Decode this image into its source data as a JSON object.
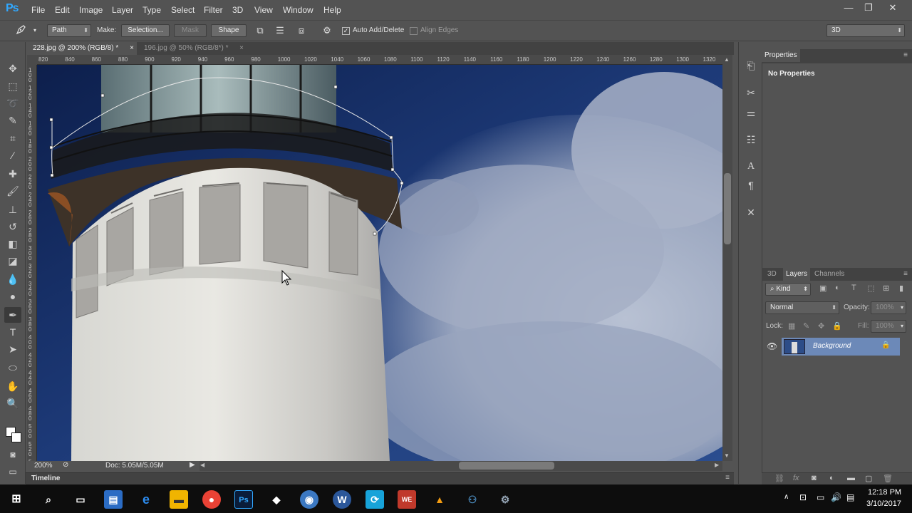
{
  "app": {
    "logo": "Ps",
    "menu": [
      "File",
      "Edit",
      "Image",
      "Layer",
      "Type",
      "Select",
      "Filter",
      "3D",
      "View",
      "Window",
      "Help"
    ],
    "window_controls": {
      "minimize": "—",
      "restore": "❐",
      "close": "✕"
    },
    "accent_color": "#31a8ff"
  },
  "options_bar": {
    "tool_icon": "pen-icon",
    "mode": "Path",
    "make_label": "Make:",
    "selection_btn": "Selection...",
    "mask_btn": "Mask",
    "shape_btn": "Shape",
    "auto_add_delete": {
      "label": "Auto Add/Delete",
      "checked": true
    },
    "align_edges": {
      "label": "Align Edges",
      "checked": false
    },
    "workspace": "3D"
  },
  "document_tabs": [
    {
      "label": "228.jpg @ 200% (RGB/8) *",
      "close": "×",
      "active": true
    },
    {
      "label": "196.jpg @ 50% (RGB/8*) *",
      "close": "×",
      "active": false
    }
  ],
  "rulers": {
    "horizontal": [
      "820",
      "840",
      "860",
      "880",
      "900",
      "920",
      "940",
      "960",
      "980",
      "1000",
      "1020",
      "1040",
      "1060",
      "1080",
      "1100",
      "1120",
      "1140",
      "1160",
      "1180",
      "1200",
      "1220",
      "1240",
      "1260",
      "1280",
      "1300",
      "1320"
    ],
    "vertical": [
      "100",
      "120",
      "140",
      "160",
      "180",
      "200",
      "220",
      "240",
      "260",
      "280",
      "300",
      "320",
      "340",
      "360",
      "380",
      "400",
      "420",
      "440",
      "460",
      "480",
      "500",
      "520",
      "540",
      "560"
    ]
  },
  "status_bar": {
    "zoom": "200%",
    "doc_info": "Doc: 5.05M/5.05M"
  },
  "timeline": {
    "label": "Timeline"
  },
  "properties_panel": {
    "title": "Properties",
    "message": "No Properties"
  },
  "layers_panel": {
    "tabs": [
      "3D",
      "Layers",
      "Channels"
    ],
    "active_tab": "Layers",
    "filter_kind": "Kind",
    "blend_mode": "Normal",
    "opacity_label": "Opacity:",
    "opacity_value": "100%",
    "lock_label": "Lock:",
    "fill_label": "Fill:",
    "fill_value": "100%",
    "layers": [
      {
        "name": "Background",
        "visible": true,
        "locked": true,
        "selected": true
      }
    ]
  },
  "taskbar": {
    "time": "12:18 PM",
    "date": "3/10/2017",
    "pinned": [
      "windows-start-icon",
      "search-icon",
      "task-view-icon",
      "explorer-icon",
      "edge-icon",
      "file-explorer-icon",
      "chrome-icon",
      "photoshop-icon",
      "inkscape-icon",
      "media-player-icon",
      "word-icon",
      "app-icon",
      "winrar-icon",
      "vlc-icon",
      "python-icon",
      "tool-icon"
    ]
  }
}
